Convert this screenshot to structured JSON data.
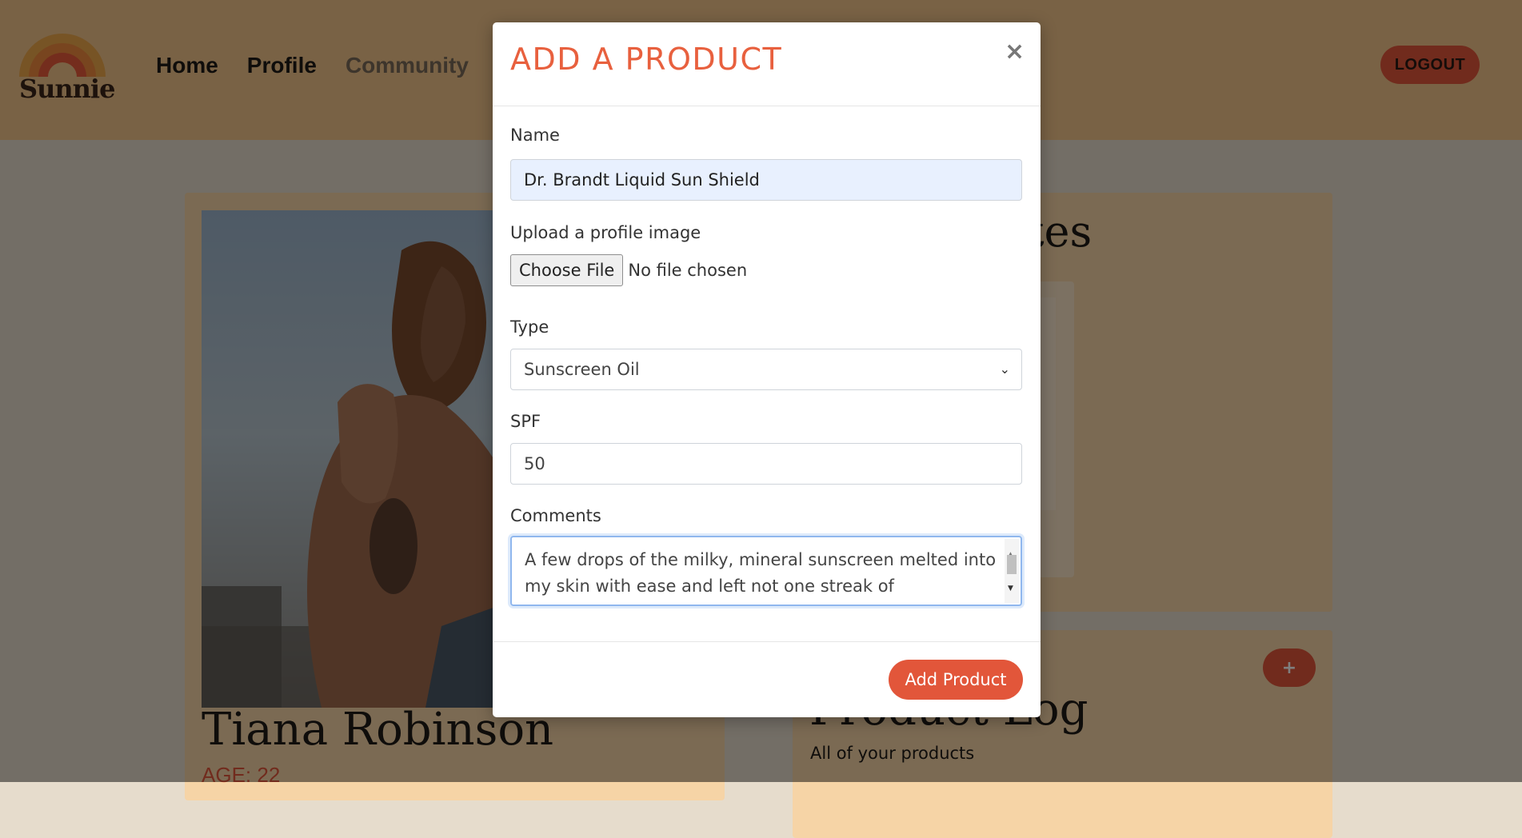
{
  "brand": {
    "name": "Sunnie"
  },
  "nav": {
    "items": [
      "Home",
      "Profile",
      "Community"
    ],
    "logout": "LOGOUT"
  },
  "profile": {
    "name": "Tiana Robinson",
    "age": "AGE: 22"
  },
  "favorites": {
    "title": "ion Favorites"
  },
  "product_log": {
    "add": "+",
    "title": "Product Log",
    "subtitle": "All of your products"
  },
  "modal": {
    "title": "ADD A PRODUCT",
    "close": "×",
    "name_label": "Name",
    "name_value": "Dr. Brandt Liquid Sun Shield",
    "image_label": "Upload a profile image",
    "file_button": "Choose File",
    "file_status": "No file chosen",
    "type_label": "Type",
    "type_value": "Sunscreen Oil",
    "spf_label": "SPF",
    "spf_value": "50",
    "comments_label": "Comments",
    "comments_value": "A few drops of the milky, mineral sunscreen melted into my skin with ease and left not one streak of",
    "submit": "Add Product"
  },
  "colors": {
    "accent": "#e2563a",
    "title": "#e8603e",
    "header_bg": "#f2c48a",
    "card_bg": "#f6d4a6"
  }
}
